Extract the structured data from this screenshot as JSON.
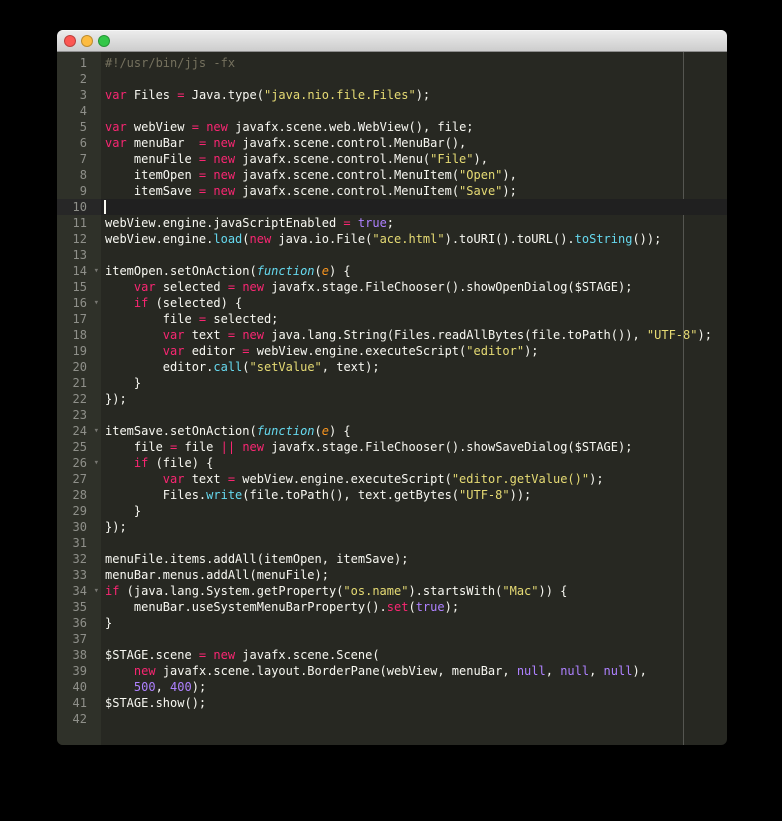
{
  "window": {
    "title": "",
    "traffic_lights": [
      "close",
      "minimize",
      "zoom"
    ]
  },
  "theme": {
    "background": "#272822",
    "text": "#F8F8F2",
    "gutter_bg": "#2F3129",
    "gutter_text": "#8F908A",
    "active_line": "#202020",
    "gutter_active_line": "#272727",
    "print_margin": "#555651",
    "cursor": "#F8F8F0",
    "keyword": "#F92672",
    "string": "#E6DB74",
    "constant": "#AE81FF",
    "support": "#66D9EF",
    "storage": "#66D9EF",
    "param": "#FD971F",
    "comment": "#75715E",
    "fold_widget": "#767671",
    "titlebar_top": "#EDEDED",
    "titlebar_bottom": "#CDCDCD",
    "titlebar_border": "#8E8E8E",
    "close": "#FC5753",
    "minimize": "#FDBC40",
    "zoom": "#33C748"
  },
  "editor": {
    "line_count": 42,
    "cursor_line": 10,
    "active_line": 10,
    "print_margin_column": 80,
    "fold_glyph": "▾",
    "lines": [
      {
        "n": 1,
        "seg": [
          [
            "c",
            "#!/usr/bin/jjs -fx"
          ]
        ]
      },
      {
        "n": 2,
        "seg": []
      },
      {
        "n": 3,
        "seg": [
          [
            "k",
            "var"
          ],
          [
            "p",
            " Files "
          ],
          [
            "k",
            "="
          ],
          [
            "p",
            " Java.type("
          ],
          [
            "s",
            "\"java.nio.file.Files\""
          ],
          [
            "p",
            ");"
          ]
        ]
      },
      {
        "n": 4,
        "seg": []
      },
      {
        "n": 5,
        "seg": [
          [
            "k",
            "var"
          ],
          [
            "p",
            " webView "
          ],
          [
            "k",
            "="
          ],
          [
            "p",
            " "
          ],
          [
            "k",
            "new"
          ],
          [
            "p",
            " javafx.scene.web.WebView(), file;"
          ]
        ]
      },
      {
        "n": 6,
        "seg": [
          [
            "k",
            "var"
          ],
          [
            "p",
            " menuBar  "
          ],
          [
            "k",
            "="
          ],
          [
            "p",
            " "
          ],
          [
            "k",
            "new"
          ],
          [
            "p",
            " javafx.scene.control.MenuBar(),"
          ]
        ]
      },
      {
        "n": 7,
        "seg": [
          [
            "p",
            "    menuFile "
          ],
          [
            "k",
            "="
          ],
          [
            "p",
            " "
          ],
          [
            "k",
            "new"
          ],
          [
            "p",
            " javafx.scene.control.Menu("
          ],
          [
            "s",
            "\"File\""
          ],
          [
            "p",
            "),"
          ]
        ]
      },
      {
        "n": 8,
        "seg": [
          [
            "p",
            "    itemOpen "
          ],
          [
            "k",
            "="
          ],
          [
            "p",
            " "
          ],
          [
            "k",
            "new"
          ],
          [
            "p",
            " javafx.scene.control.MenuItem("
          ],
          [
            "s",
            "\"Open\""
          ],
          [
            "p",
            "),"
          ]
        ]
      },
      {
        "n": 9,
        "seg": [
          [
            "p",
            "    itemSave "
          ],
          [
            "k",
            "="
          ],
          [
            "p",
            " "
          ],
          [
            "k",
            "new"
          ],
          [
            "p",
            " javafx.scene.control.MenuItem("
          ],
          [
            "s",
            "\"Save\""
          ],
          [
            "p",
            ");"
          ]
        ]
      },
      {
        "n": 10,
        "seg": []
      },
      {
        "n": 11,
        "seg": [
          [
            "p",
            "webView.engine.javaScriptEnabled "
          ],
          [
            "k",
            "="
          ],
          [
            "p",
            " "
          ],
          [
            "n",
            "true"
          ],
          [
            "p",
            ";"
          ]
        ]
      },
      {
        "n": 12,
        "seg": [
          [
            "p",
            "webView.engine."
          ],
          [
            "f",
            "load"
          ],
          [
            "p",
            "("
          ],
          [
            "k",
            "new"
          ],
          [
            "p",
            " java.io.File("
          ],
          [
            "s",
            "\"ace.html\""
          ],
          [
            "p",
            ").toURI().toURL()."
          ],
          [
            "f",
            "toString"
          ],
          [
            "p",
            "());"
          ]
        ]
      },
      {
        "n": 13,
        "seg": []
      },
      {
        "n": 14,
        "fold": true,
        "seg": [
          [
            "p",
            "itemOpen.setOnAction("
          ],
          [
            "t",
            "function"
          ],
          [
            "p",
            "("
          ],
          [
            "a",
            "e"
          ],
          [
            "p",
            ") {"
          ]
        ]
      },
      {
        "n": 15,
        "seg": [
          [
            "p",
            "    "
          ],
          [
            "k",
            "var"
          ],
          [
            "p",
            " selected "
          ],
          [
            "k",
            "="
          ],
          [
            "p",
            " "
          ],
          [
            "k",
            "new"
          ],
          [
            "p",
            " javafx.stage.FileChooser().showOpenDialog($STAGE);"
          ]
        ]
      },
      {
        "n": 16,
        "fold": true,
        "seg": [
          [
            "p",
            "    "
          ],
          [
            "k",
            "if"
          ],
          [
            "p",
            " (selected) {"
          ]
        ]
      },
      {
        "n": 17,
        "seg": [
          [
            "p",
            "        file "
          ],
          [
            "k",
            "="
          ],
          [
            "p",
            " selected;"
          ]
        ]
      },
      {
        "n": 18,
        "seg": [
          [
            "p",
            "        "
          ],
          [
            "k",
            "var"
          ],
          [
            "p",
            " text "
          ],
          [
            "k",
            "="
          ],
          [
            "p",
            " "
          ],
          [
            "k",
            "new"
          ],
          [
            "p",
            " java.lang.String(Files.readAllBytes(file.toPath()), "
          ],
          [
            "s",
            "\"UTF-8\""
          ],
          [
            "p",
            ");"
          ]
        ]
      },
      {
        "n": 19,
        "seg": [
          [
            "p",
            "        "
          ],
          [
            "k",
            "var"
          ],
          [
            "p",
            " editor "
          ],
          [
            "k",
            "="
          ],
          [
            "p",
            " webView.engine.executeScript("
          ],
          [
            "s",
            "\"editor\""
          ],
          [
            "p",
            ");"
          ]
        ]
      },
      {
        "n": 20,
        "seg": [
          [
            "p",
            "        editor."
          ],
          [
            "f",
            "call"
          ],
          [
            "p",
            "("
          ],
          [
            "s",
            "\"setValue\""
          ],
          [
            "p",
            ", text);"
          ]
        ]
      },
      {
        "n": 21,
        "seg": [
          [
            "p",
            "    }"
          ]
        ]
      },
      {
        "n": 22,
        "seg": [
          [
            "p",
            "});"
          ]
        ]
      },
      {
        "n": 23,
        "seg": []
      },
      {
        "n": 24,
        "fold": true,
        "seg": [
          [
            "p",
            "itemSave.setOnAction("
          ],
          [
            "t",
            "function"
          ],
          [
            "p",
            "("
          ],
          [
            "a",
            "e"
          ],
          [
            "p",
            ") {"
          ]
        ]
      },
      {
        "n": 25,
        "seg": [
          [
            "p",
            "    file "
          ],
          [
            "k",
            "="
          ],
          [
            "p",
            " file "
          ],
          [
            "k",
            "||"
          ],
          [
            "p",
            " "
          ],
          [
            "k",
            "new"
          ],
          [
            "p",
            " javafx.stage.FileChooser().showSaveDialog($STAGE);"
          ]
        ]
      },
      {
        "n": 26,
        "fold": true,
        "seg": [
          [
            "p",
            "    "
          ],
          [
            "k",
            "if"
          ],
          [
            "p",
            " (file) {"
          ]
        ]
      },
      {
        "n": 27,
        "seg": [
          [
            "p",
            "        "
          ],
          [
            "k",
            "var"
          ],
          [
            "p",
            " text "
          ],
          [
            "k",
            "="
          ],
          [
            "p",
            " webView.engine.executeScript("
          ],
          [
            "s",
            "\"editor.getValue()\""
          ],
          [
            "p",
            ");"
          ]
        ]
      },
      {
        "n": 28,
        "seg": [
          [
            "p",
            "        Files."
          ],
          [
            "f",
            "write"
          ],
          [
            "p",
            "(file.toPath(), text.getBytes("
          ],
          [
            "s",
            "\"UTF-8\""
          ],
          [
            "p",
            "));"
          ]
        ]
      },
      {
        "n": 29,
        "seg": [
          [
            "p",
            "    }"
          ]
        ]
      },
      {
        "n": 30,
        "seg": [
          [
            "p",
            "});"
          ]
        ]
      },
      {
        "n": 31,
        "seg": []
      },
      {
        "n": 32,
        "seg": [
          [
            "p",
            "menuFile.items.addAll(itemOpen, itemSave);"
          ]
        ]
      },
      {
        "n": 33,
        "seg": [
          [
            "p",
            "menuBar.menus.addAll(menuFile);"
          ]
        ]
      },
      {
        "n": 34,
        "fold": true,
        "seg": [
          [
            "k",
            "if"
          ],
          [
            "p",
            " (java.lang.System.getProperty("
          ],
          [
            "s",
            "\"os.name\""
          ],
          [
            "p",
            ").startsWith("
          ],
          [
            "s",
            "\"Mac\""
          ],
          [
            "p",
            ")) {"
          ]
        ]
      },
      {
        "n": 35,
        "seg": [
          [
            "p",
            "    menuBar.useSystemMenuBarProperty()."
          ],
          [
            "k",
            "set"
          ],
          [
            "p",
            "("
          ],
          [
            "n",
            "true"
          ],
          [
            "p",
            ");"
          ]
        ]
      },
      {
        "n": 36,
        "seg": [
          [
            "p",
            "}"
          ]
        ]
      },
      {
        "n": 37,
        "seg": []
      },
      {
        "n": 38,
        "seg": [
          [
            "p",
            "$STAGE.scene "
          ],
          [
            "k",
            "="
          ],
          [
            "p",
            " "
          ],
          [
            "k",
            "new"
          ],
          [
            "p",
            " javafx.scene.Scene("
          ]
        ]
      },
      {
        "n": 39,
        "seg": [
          [
            "p",
            "    "
          ],
          [
            "k",
            "new"
          ],
          [
            "p",
            " javafx.scene.layout.BorderPane(webView, menuBar, "
          ],
          [
            "n",
            "null"
          ],
          [
            "p",
            ", "
          ],
          [
            "n",
            "null"
          ],
          [
            "p",
            ", "
          ],
          [
            "n",
            "null"
          ],
          [
            "p",
            "),"
          ]
        ]
      },
      {
        "n": 40,
        "seg": [
          [
            "p",
            "    "
          ],
          [
            "n",
            "500"
          ],
          [
            "p",
            ", "
          ],
          [
            "n",
            "400"
          ],
          [
            "p",
            ");"
          ]
        ]
      },
      {
        "n": 41,
        "seg": [
          [
            "p",
            "$STAGE.show();"
          ]
        ]
      },
      {
        "n": 42,
        "seg": []
      }
    ]
  }
}
